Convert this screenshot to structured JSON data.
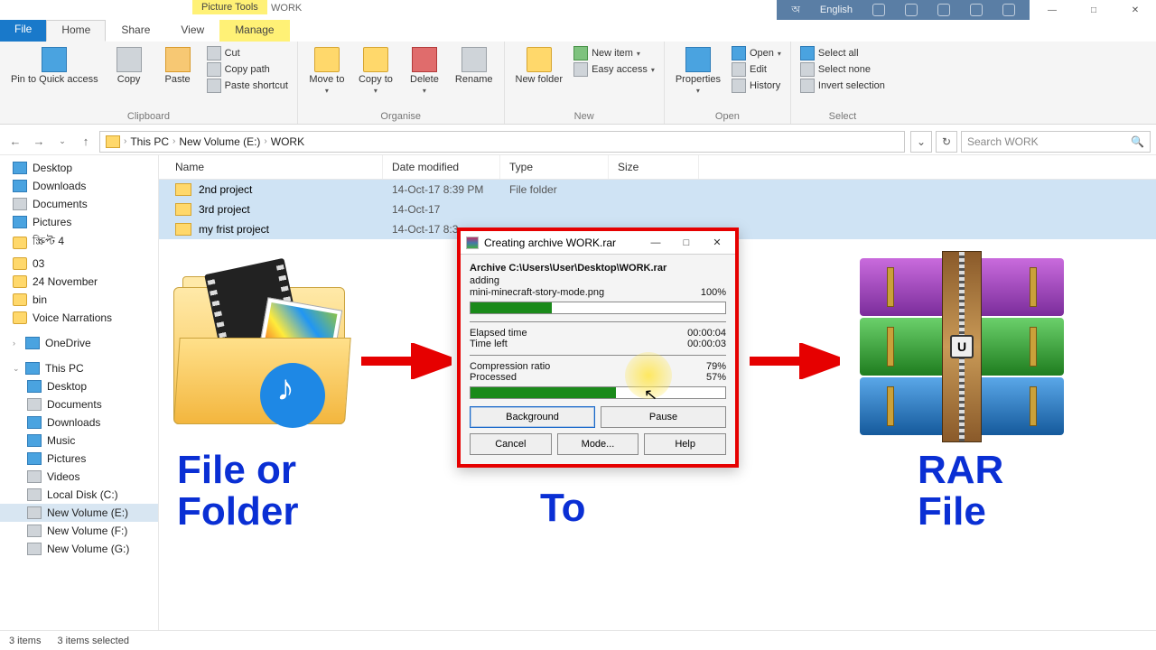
{
  "titlebar": {
    "context_tab": "Picture Tools",
    "context_title": "WORK",
    "lang_code": "অ",
    "lang_name": "English",
    "win_min": "—",
    "win_max": "□",
    "win_close": "✕"
  },
  "tabs": {
    "file": "File",
    "home": "Home",
    "share": "Share",
    "view": "View",
    "manage": "Manage"
  },
  "ribbon": {
    "clipboard": {
      "pin": "Pin to Quick access",
      "copy": "Copy",
      "paste": "Paste",
      "cut": "Cut",
      "copy_path": "Copy path",
      "paste_shortcut": "Paste shortcut",
      "label": "Clipboard"
    },
    "organise": {
      "move_to": "Move to",
      "copy_to": "Copy to",
      "delete": "Delete",
      "rename": "Rename",
      "label": "Organise"
    },
    "new": {
      "new_folder": "New folder",
      "new_item": "New item",
      "easy_access": "Easy access",
      "label": "New"
    },
    "open": {
      "properties": "Properties",
      "open": "Open",
      "edit": "Edit",
      "history": "History",
      "label": "Open"
    },
    "select": {
      "select_all": "Select all",
      "select_none": "Select none",
      "invert": "Invert selection",
      "label": "Select"
    }
  },
  "nav": {
    "back": "←",
    "fwd": "→",
    "up": "↑",
    "seg1": "This PC",
    "seg2": "New Volume (E:)",
    "seg3": "WORK",
    "refresh": "↻",
    "dd": "⌄"
  },
  "search": {
    "placeholder": "Search WORK",
    "icon": "🔍"
  },
  "tree": {
    "desktop": "Desktop",
    "downloads": "Downloads",
    "documents": "Documents",
    "pictures": "Pictures",
    "custom1": "স্ক্রিপ্ট 4",
    "n03": "03",
    "nov": "24 November",
    "bin": "bin",
    "voice": "Voice Narrations",
    "onedrive": "OneDrive",
    "thispc": "This PC",
    "pc_desktop": "Desktop",
    "pc_documents": "Documents",
    "pc_downloads": "Downloads",
    "pc_music": "Music",
    "pc_pictures": "Pictures",
    "pc_videos": "Videos",
    "localc": "Local Disk (C:)",
    "vole": "New Volume (E:)",
    "volf": "New Volume (F:)",
    "volg": "New Volume (G:)"
  },
  "columns": {
    "name": "Name",
    "date": "Date modified",
    "type": "Type",
    "size": "Size"
  },
  "rows": [
    {
      "name": "2nd project",
      "date": "14-Oct-17 8:39 PM",
      "type": "File folder"
    },
    {
      "name": "3rd project",
      "date": "14-Oct-17",
      "type": ""
    },
    {
      "name": "my frist project",
      "date": "14-Oct-17 8:3",
      "type": ""
    }
  ],
  "status": {
    "items": "3 items",
    "selected": "3 items selected"
  },
  "dialog": {
    "title": "Creating archive WORK.rar",
    "archive_line": "Archive C:\\Users\\User\\Desktop\\WORK.rar",
    "adding": "adding",
    "file": "mini-minecraft-story-mode.png",
    "file_pct": "100%",
    "elapsed_l": "Elapsed time",
    "elapsed_v": "00:00:04",
    "left_l": "Time left",
    "left_v": "00:00:03",
    "ratio_l": "Compression ratio",
    "ratio_v": "79%",
    "proc_l": "Processed",
    "proc_v": "57%",
    "btn_bg": "Background",
    "btn_pause": "Pause",
    "btn_cancel": "Cancel",
    "btn_mode": "Mode...",
    "btn_help": "Help",
    "min": "—",
    "max": "□",
    "close": "✕"
  },
  "captions": {
    "left1": "File or",
    "left2": "Folder",
    "mid": "To",
    "right1": "RAR",
    "right2": "File"
  },
  "rar_pull": "U"
}
